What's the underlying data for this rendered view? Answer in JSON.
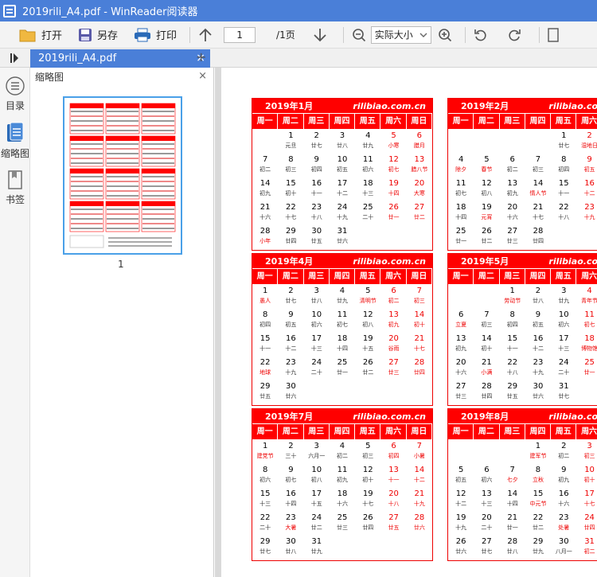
{
  "app": {
    "title": "2019rili_A4.pdf - WinReader阅读器"
  },
  "toolbar": {
    "open": "打开",
    "saveas": "另存",
    "print": "打印",
    "page_current": "1",
    "page_total": "/1页",
    "zoom": "实际大小"
  },
  "tab": {
    "name": "2019rili_A4.pdf",
    "close": "×",
    "add": "+"
  },
  "leftnav": {
    "toc": "目录",
    "thumbs": "缩略图",
    "bookmarks": "书签"
  },
  "sidepanel": {
    "title": "缩略图",
    "close": "×",
    "page_label": "1"
  },
  "calendar": {
    "site": "rilibiao.com.cn",
    "weekdays": [
      "周一",
      "周二",
      "周三",
      "周四",
      "周五",
      "周六",
      "周日"
    ],
    "months": [
      {
        "title": "2019年1月",
        "offset": 1,
        "days": [
          [
            "1",
            "元旦"
          ],
          [
            "2",
            "廿七"
          ],
          [
            "3",
            "廿八"
          ],
          [
            "4",
            "廿九"
          ],
          [
            "5",
            "小寒"
          ],
          [
            "6",
            "腊月"
          ],
          [
            "7",
            "初二"
          ],
          [
            "8",
            "初三"
          ],
          [
            "9",
            "初四"
          ],
          [
            "10",
            "初五"
          ],
          [
            "11",
            "初六"
          ],
          [
            "12",
            "初七"
          ],
          [
            "13",
            "腊八节"
          ],
          [
            "14",
            "初九"
          ],
          [
            "15",
            "初十"
          ],
          [
            "16",
            "十一"
          ],
          [
            "17",
            "十二"
          ],
          [
            "18",
            "十三"
          ],
          [
            "19",
            "十四"
          ],
          [
            "20",
            "大寒"
          ],
          [
            "21",
            "十六"
          ],
          [
            "22",
            "十七"
          ],
          [
            "23",
            "十八"
          ],
          [
            "24",
            "十九"
          ],
          [
            "25",
            "二十"
          ],
          [
            "26",
            "廿一"
          ],
          [
            "27",
            "廿二"
          ],
          [
            "28",
            "小年"
          ],
          [
            "29",
            "廿四"
          ],
          [
            "30",
            "廿五"
          ],
          [
            "31",
            "廿六"
          ]
        ]
      },
      {
        "title": "2019年2月",
        "offset": 4,
        "days": [
          [
            "1",
            "廿七"
          ],
          [
            "2",
            "湿地日"
          ],
          [
            "3",
            "廿九"
          ],
          [
            "4",
            "除夕"
          ],
          [
            "5",
            "春节"
          ],
          [
            "6",
            "初二"
          ],
          [
            "7",
            "初三"
          ],
          [
            "8",
            "初四"
          ],
          [
            "9",
            "初五"
          ],
          [
            "10",
            "初六"
          ],
          [
            "11",
            "初七"
          ],
          [
            "12",
            "初八"
          ],
          [
            "13",
            "初九"
          ],
          [
            "14",
            "情人节"
          ],
          [
            "15",
            "十一"
          ],
          [
            "16",
            "十二"
          ],
          [
            "17",
            "十三"
          ],
          [
            "18",
            "十四"
          ],
          [
            "19",
            "元宵"
          ],
          [
            "20",
            "十六"
          ],
          [
            "21",
            "十七"
          ],
          [
            "22",
            "十八"
          ],
          [
            "23",
            "十九"
          ],
          [
            "24",
            "二十"
          ],
          [
            "25",
            "廿一"
          ],
          [
            "26",
            "廿二"
          ],
          [
            "27",
            "廿三"
          ],
          [
            "28",
            "廿四"
          ]
        ]
      },
      {
        "title": "2019年4月",
        "offset": 0,
        "days": [
          [
            "1",
            "愚人"
          ],
          [
            "2",
            "廿七"
          ],
          [
            "3",
            "廿八"
          ],
          [
            "4",
            "廿九"
          ],
          [
            "5",
            "清明节"
          ],
          [
            "6",
            "初二"
          ],
          [
            "7",
            "初三"
          ],
          [
            "8",
            "初四"
          ],
          [
            "9",
            "初五"
          ],
          [
            "10",
            "初六"
          ],
          [
            "11",
            "初七"
          ],
          [
            "12",
            "初八"
          ],
          [
            "13",
            "初九"
          ],
          [
            "14",
            "初十"
          ],
          [
            "15",
            "十一"
          ],
          [
            "16",
            "十二"
          ],
          [
            "17",
            "十三"
          ],
          [
            "18",
            "十四"
          ],
          [
            "19",
            "十五"
          ],
          [
            "20",
            "谷雨"
          ],
          [
            "21",
            "十七"
          ],
          [
            "22",
            "地球"
          ],
          [
            "23",
            "十九"
          ],
          [
            "24",
            "二十"
          ],
          [
            "25",
            "廿一"
          ],
          [
            "26",
            "廿二"
          ],
          [
            "27",
            "廿三"
          ],
          [
            "28",
            "廿四"
          ],
          [
            "29",
            "廿五"
          ],
          [
            "30",
            "廿六"
          ]
        ]
      },
      {
        "title": "2019年5月",
        "offset": 2,
        "days": [
          [
            "1",
            "劳动节"
          ],
          [
            "2",
            "廿八"
          ],
          [
            "3",
            "廿九"
          ],
          [
            "4",
            "青年节"
          ],
          [
            "5",
            "初一"
          ],
          [
            "6",
            "立夏"
          ],
          [
            "7",
            "初三"
          ],
          [
            "8",
            "初四"
          ],
          [
            "9",
            "初五"
          ],
          [
            "10",
            "初六"
          ],
          [
            "11",
            "初七"
          ],
          [
            "12",
            "初八"
          ],
          [
            "13",
            "初九"
          ],
          [
            "14",
            "初十"
          ],
          [
            "15",
            "十一"
          ],
          [
            "16",
            "十二"
          ],
          [
            "17",
            "十三"
          ],
          [
            "18",
            "博物馆"
          ],
          [
            "19",
            "十五"
          ],
          [
            "20",
            "十六"
          ],
          [
            "21",
            "小满"
          ],
          [
            "22",
            "十八"
          ],
          [
            "23",
            "十九"
          ],
          [
            "24",
            "二十"
          ],
          [
            "25",
            "廿一"
          ],
          [
            "26",
            "廿二"
          ],
          [
            "27",
            "廿三"
          ],
          [
            "28",
            "廿四"
          ],
          [
            "29",
            "廿五"
          ],
          [
            "30",
            "廿六"
          ],
          [
            "31",
            "廿七"
          ]
        ]
      },
      {
        "title": "2019年7月",
        "offset": 0,
        "days": [
          [
            "1",
            "建党节"
          ],
          [
            "2",
            "三十"
          ],
          [
            "3",
            "六月一"
          ],
          [
            "4",
            "初二"
          ],
          [
            "5",
            "初三"
          ],
          [
            "6",
            "初四"
          ],
          [
            "7",
            "小暑"
          ],
          [
            "8",
            "初六"
          ],
          [
            "9",
            "初七"
          ],
          [
            "10",
            "初八"
          ],
          [
            "11",
            "初九"
          ],
          [
            "12",
            "初十"
          ],
          [
            "13",
            "十一"
          ],
          [
            "14",
            "十二"
          ],
          [
            "15",
            "十三"
          ],
          [
            "16",
            "十四"
          ],
          [
            "17",
            "十五"
          ],
          [
            "18",
            "十六"
          ],
          [
            "19",
            "十七"
          ],
          [
            "20",
            "十八"
          ],
          [
            "21",
            "十九"
          ],
          [
            "22",
            "二十"
          ],
          [
            "23",
            "大暑"
          ],
          [
            "24",
            "廿二"
          ],
          [
            "25",
            "廿三"
          ],
          [
            "26",
            "廿四"
          ],
          [
            "27",
            "廿五"
          ],
          [
            "28",
            "廿六"
          ],
          [
            "29",
            "廿七"
          ],
          [
            "30",
            "廿八"
          ],
          [
            "31",
            "廿九"
          ]
        ]
      },
      {
        "title": "2019年8月",
        "offset": 3,
        "days": [
          [
            "1",
            "建军节"
          ],
          [
            "2",
            "初二"
          ],
          [
            "3",
            "初三"
          ],
          [
            "4",
            "初四"
          ],
          [
            "5",
            "初五"
          ],
          [
            "6",
            "初六"
          ],
          [
            "7",
            "七夕"
          ],
          [
            "8",
            "立秋"
          ],
          [
            "9",
            "初九"
          ],
          [
            "10",
            "初十"
          ],
          [
            "11",
            "十一"
          ],
          [
            "12",
            "十二"
          ],
          [
            "13",
            "十三"
          ],
          [
            "14",
            "十四"
          ],
          [
            "15",
            "中元节"
          ],
          [
            "16",
            "十六"
          ],
          [
            "17",
            "十七"
          ],
          [
            "18",
            "十八"
          ],
          [
            "19",
            "十九"
          ],
          [
            "20",
            "二十"
          ],
          [
            "21",
            "廿一"
          ],
          [
            "22",
            "廿二"
          ],
          [
            "23",
            "处暑"
          ],
          [
            "24",
            "廿四"
          ],
          [
            "25",
            "廿五"
          ],
          [
            "26",
            "廿六"
          ],
          [
            "27",
            "廿七"
          ],
          [
            "28",
            "廿八"
          ],
          [
            "29",
            "廿九"
          ],
          [
            "30",
            "八月一"
          ],
          [
            "31",
            "初二"
          ]
        ]
      }
    ]
  },
  "colors": {
    "accent": "#4a7fd8",
    "calendar_red": "#ff0000"
  }
}
